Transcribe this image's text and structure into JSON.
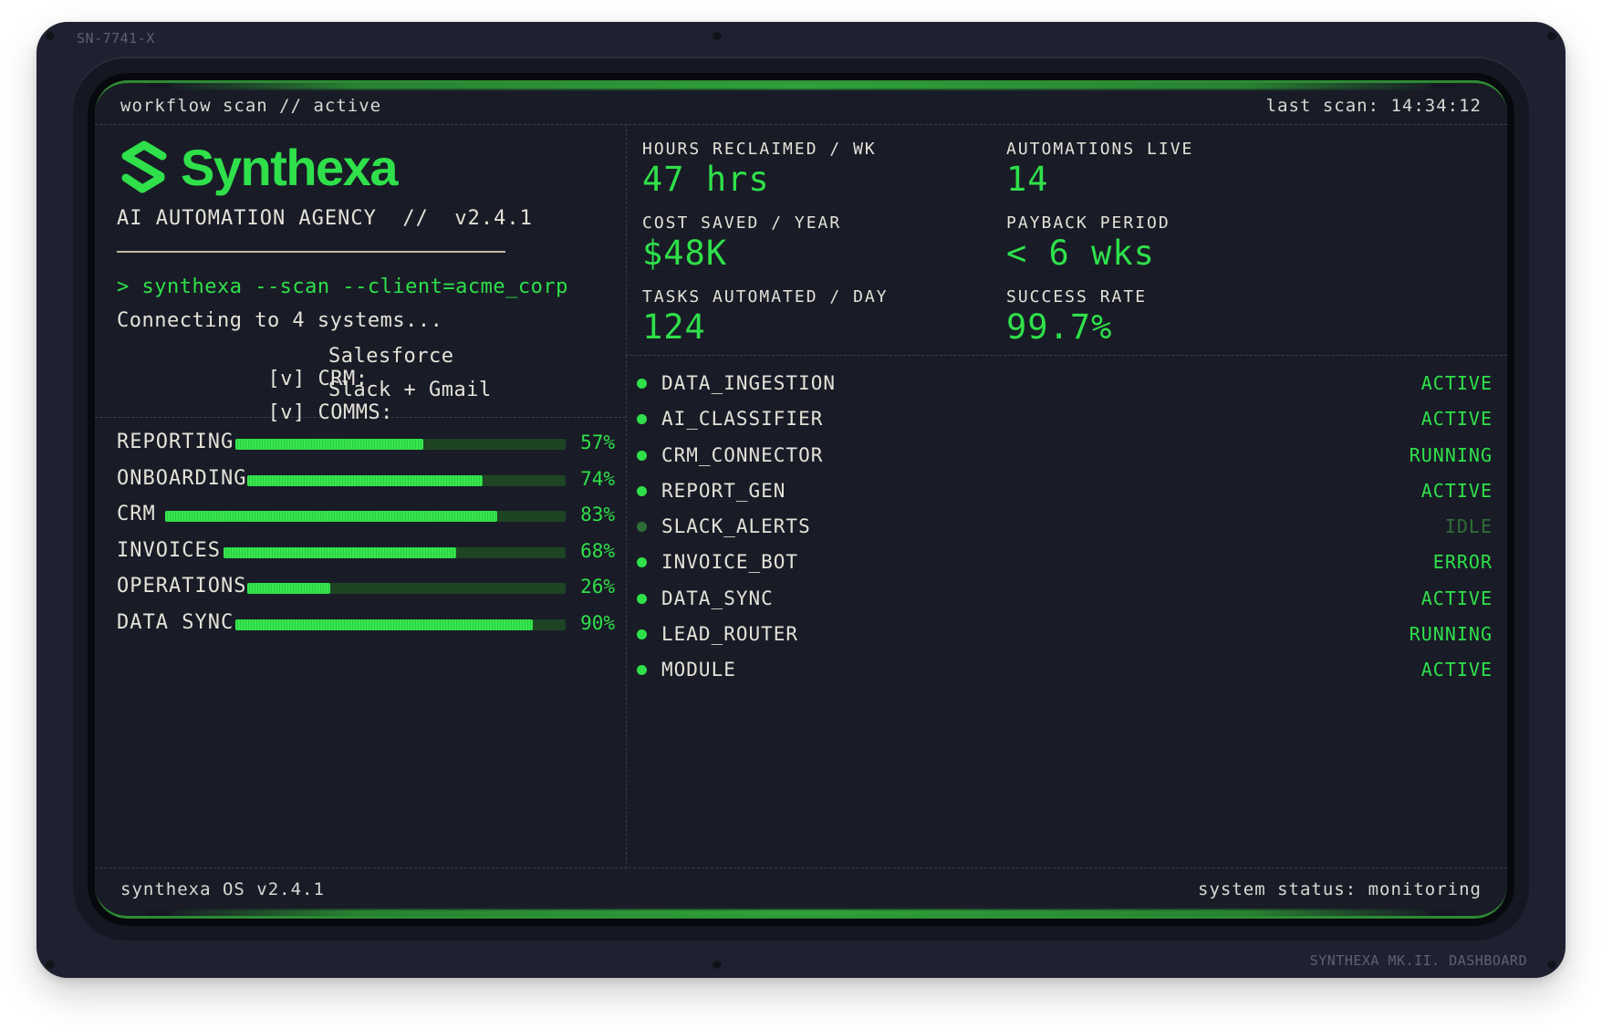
{
  "device": {
    "serial": "SN-7741-X",
    "plate": "SYNTHEXA MK.II. DASHBOARD"
  },
  "topbar": {
    "left": "workflow scan // active",
    "right": "last scan: 14:34:12"
  },
  "brand": {
    "name": "Synthexa",
    "tagline": "AI AUTOMATION AGENCY  //  v2.4.1",
    "logo_icon": "s-logo-icon"
  },
  "terminal": {
    "command": "> synthexa --scan --client=acme_corp",
    "status": "Connecting to 4 systems...",
    "systems": [
      {
        "check": "[v]",
        "label": "CRM:",
        "value": "Salesforce"
      },
      {
        "check": "[v]",
        "label": "COMMS:",
        "value": "Slack + Gmail"
      }
    ]
  },
  "progress": [
    {
      "label": "REPORTING",
      "value": 57,
      "text": "57%"
    },
    {
      "label": "ONBOARDING",
      "value": 74,
      "text": "74%"
    },
    {
      "label": "CRM",
      "value": 83,
      "text": "83%"
    },
    {
      "label": "INVOICES",
      "value": 68,
      "text": "68%"
    },
    {
      "label": "OPERATIONS",
      "value": 26,
      "text": "26%"
    },
    {
      "label": "DATA SYNC",
      "value": 90,
      "text": "90%"
    }
  ],
  "metrics": [
    {
      "key": "HOURS RECLAIMED / WK",
      "value": "47 hrs"
    },
    {
      "key": "AUTOMATIONS LIVE",
      "value": "14"
    },
    {
      "key": "COST SAVED / YEAR",
      "value": "$48K"
    },
    {
      "key": "PAYBACK PERIOD",
      "value": "< 6 wks"
    },
    {
      "key": "TASKS AUTOMATED / DAY",
      "value": "124"
    },
    {
      "key": "SUCCESS RATE",
      "value": "99.7%"
    }
  ],
  "services": [
    {
      "name": "DATA_INGESTION",
      "status": "ACTIVE"
    },
    {
      "name": "AI_CLASSIFIER",
      "status": "ACTIVE"
    },
    {
      "name": "CRM_CONNECTOR",
      "status": "RUNNING"
    },
    {
      "name": "REPORT_GEN",
      "status": "ACTIVE"
    },
    {
      "name": "SLACK_ALERTS",
      "status": "IDLE"
    },
    {
      "name": "INVOICE_BOT",
      "status": "ERROR"
    },
    {
      "name": "DATA_SYNC",
      "status": "ACTIVE"
    },
    {
      "name": "LEAD_ROUTER",
      "status": "RUNNING"
    },
    {
      "name": "MODULE",
      "status": "ACTIVE"
    }
  ],
  "bottombar": {
    "left": "synthexa OS v2.4.1",
    "right": "system status: monitoring"
  },
  "colors": {
    "accent": "#2fe04a",
    "dim_accent": "#2f6e37",
    "text": "#e4e2d8",
    "background": "#181b26"
  }
}
